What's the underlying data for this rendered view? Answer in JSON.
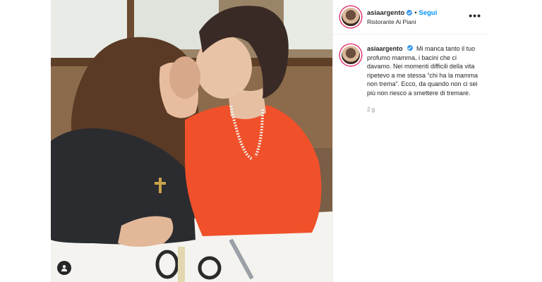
{
  "post": {
    "username": "asiaargento",
    "follow_label": "Segui",
    "separator": "•",
    "location": "Ristorante Ai Piani",
    "more_label": "•••",
    "caption": "Mi manca tanto il tuo profumo mamma, i bacini che ci davamo. Nei momenti difficili della vita ripetevo a me stessa “chi ha la mamma non trema”. Ecco, da quando non ci sei più non riesco a smettere di tremare.",
    "timestamp": "2 g",
    "icons": {
      "verified": "verified-badge-icon",
      "tag": "user-tag-icon",
      "more": "more-options-icon"
    },
    "colors": {
      "follow": "#0095f6",
      "verified": "#3897f0",
      "shirt": "#f0502a"
    }
  }
}
